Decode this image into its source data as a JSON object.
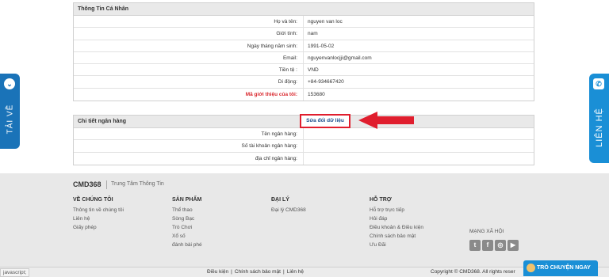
{
  "profile": {
    "title": "Thông Tin Cá Nhân",
    "rows": [
      {
        "label": "Họ và tên:",
        "value": "nguyen van loc"
      },
      {
        "label": "Giới tính:",
        "value": "nam"
      },
      {
        "label": "Ngày tháng năm sinh:",
        "value": "1991-05-02"
      },
      {
        "label": "Email:",
        "value": "nguyenvanlocjji@gmail.com"
      },
      {
        "label": "Tiền tệ :",
        "value": "VND"
      },
      {
        "label": "Di động:",
        "value": "+84-934667420"
      },
      {
        "label": "Mã giới thiệu của tôi:",
        "value": "153680"
      }
    ]
  },
  "bank": {
    "title": "Chi tiết ngân hàng",
    "edit_label": "Sửa đổi dữ liệu",
    "rows": [
      {
        "label": "Tên ngân hàng:",
        "value": ""
      },
      {
        "label": "Số tài khoản ngân hàng:",
        "value": ""
      },
      {
        "label": "địa chỉ ngân hàng:",
        "value": ""
      }
    ]
  },
  "side": {
    "left_label": "TẢI VỀ",
    "right_label": "LIÊN HỆ"
  },
  "footer": {
    "brand": "CMD368",
    "brand_sub": "Trung Tâm Thông Tin",
    "cols": [
      {
        "title": "VỀ CHÚNG TÔI",
        "links": [
          "Thông tin về chúng tôi",
          "Liên hệ",
          "Giấy phép"
        ]
      },
      {
        "title": "SẢN PHẨM",
        "links": [
          "Thể thao",
          "Sòng Bạc",
          "Trò Chơi",
          "Xổ số",
          "đánh bài phé"
        ]
      },
      {
        "title": "ĐẠI LÝ",
        "links": [
          "Đại lý CMD368"
        ]
      },
      {
        "title": "HỖ TRỢ",
        "links": [
          "Hỗ trợ trực tiếp",
          "Hỏi đáp",
          "Điều khoản & Điều kiện",
          "Chính sách bảo mật",
          "Ưu Đãi"
        ]
      }
    ],
    "social_title": "MẠNG XÃ HỘI",
    "social_icons": [
      "twitter-icon",
      "facebook-icon",
      "weibo-icon",
      "youtube-icon"
    ]
  },
  "bottom": {
    "status": "javascript;",
    "links": [
      "Điều kiện",
      "Chính sách bảo mật",
      "Liên hệ"
    ],
    "copyright": "Copyright © CMD368. All rights reser",
    "chat_label": "TRÒ CHUYỆN NGAY"
  }
}
